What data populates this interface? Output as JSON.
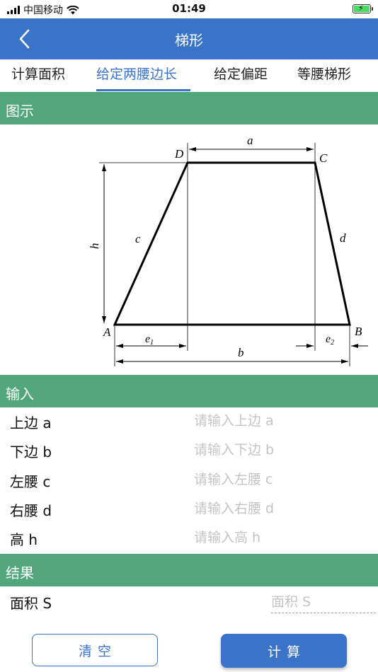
{
  "status_bar": {
    "carrier": "中国移动",
    "time": "01:49"
  },
  "nav": {
    "title": "梯形"
  },
  "tabs": [
    {
      "label": "计算面积"
    },
    {
      "label": "给定两腰边长"
    },
    {
      "label": "给定偏距"
    },
    {
      "label": "等腰梯形"
    }
  ],
  "active_tab": 1,
  "sections": {
    "diagram": "图示",
    "input": "输入",
    "result": "结果"
  },
  "diagram_labels": {
    "A": "A",
    "B": "B",
    "C": "C",
    "D": "D",
    "a": "a",
    "b": "b",
    "c": "c",
    "d": "d",
    "h": "h",
    "e1": "e",
    "e1_sub": "1",
    "e2": "e",
    "e2_sub": "2"
  },
  "inputs": [
    {
      "label": "上边 a",
      "placeholder": "请输入上边 a",
      "value": ""
    },
    {
      "label": "下边 b",
      "placeholder": "请输入下边 b",
      "value": ""
    },
    {
      "label": "左腰 c",
      "placeholder": "请输入左腰 c",
      "value": ""
    },
    {
      "label": "右腰 d",
      "placeholder": "请输入右腰 d",
      "value": ""
    },
    {
      "label": "高 h",
      "placeholder": "请输入高 h",
      "value": ""
    }
  ],
  "results": [
    {
      "label": "面积 S",
      "placeholder": "面积 S",
      "value": ""
    }
  ],
  "buttons": {
    "clear": "清空",
    "calculate": "计算"
  },
  "colors": {
    "primary": "#3a73c8",
    "section": "#52a67c",
    "placeholder": "#c4c4c4"
  }
}
